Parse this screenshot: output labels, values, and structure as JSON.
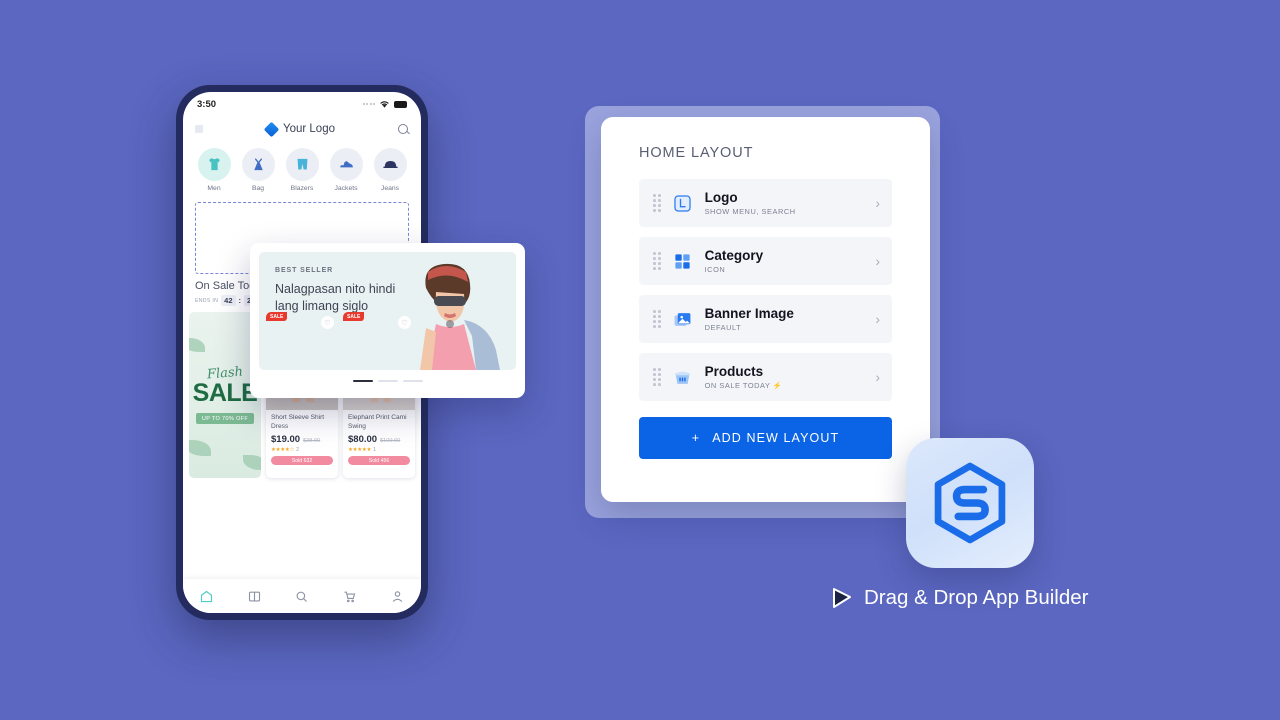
{
  "background_color": "#5b67c0",
  "phone": {
    "status_bar": {
      "time": "3:50",
      "wifi_icon": "wifi-icon",
      "battery_icon": "battery-icon",
      "signal_icon": "signal-dots-icon"
    },
    "app_header": {
      "menu_icon": "grid-menu-icon",
      "logo_icon": "diamond-logo-icon",
      "title": "Your Logo",
      "search_icon": "search-icon"
    },
    "categories": [
      {
        "label": "Men",
        "icon": "tshirt-icon"
      },
      {
        "label": "Bag",
        "icon": "dress-icon"
      },
      {
        "label": "Blazers",
        "icon": "shorts-icon"
      },
      {
        "label": "Jackets",
        "icon": "shoe-icon"
      },
      {
        "label": "Jeans",
        "icon": "cap-icon"
      }
    ],
    "on_sale": {
      "title": "On Sale Today",
      "ends_in_label": "ENDS IN",
      "hours": "42",
      "separator": ":",
      "minutes": "24"
    },
    "flash_banner": {
      "script_text": "Flash",
      "headline": "SALE",
      "pill": "UP TO 70% OFF"
    },
    "products": [
      {
        "tag": "SALE",
        "name": "Short Sleeve Shirt Dress",
        "price": "$19.00",
        "old_price": "$38.00",
        "stars": "★★★★☆",
        "rating_count": "2",
        "sold": "Sold 632",
        "favorite_icon": "heart-icon"
      },
      {
        "tag": "SALE",
        "name": "Elephant Print Cami Swing",
        "price": "$80.00",
        "old_price": "$100.00",
        "stars": "★★★★★",
        "rating_count": "1",
        "sold": "Sold 456",
        "favorite_icon": "heart-icon"
      }
    ],
    "bottom_nav": [
      {
        "icon": "home-icon",
        "active": true
      },
      {
        "icon": "book-icon",
        "active": false
      },
      {
        "icon": "search-icon",
        "active": false
      },
      {
        "icon": "cart-icon",
        "active": false
      },
      {
        "icon": "profile-icon",
        "active": false
      }
    ]
  },
  "best_seller_card": {
    "eyebrow": "BEST SELLER",
    "headline": "Nalagpasan nito hindi lang limang siglo",
    "image": "woman-with-sunglasses-photo",
    "pagination_dots": 3,
    "active_dot": 0
  },
  "builder_panel": {
    "title": "HOME LAYOUT",
    "rows": [
      {
        "title": "Logo",
        "subtitle": "SHOW MENU, SEARCH",
        "icon": "logo-letter-l-icon",
        "drag_handle": "drag-handle-icon",
        "chevron": "chevron-right-icon"
      },
      {
        "title": "Category",
        "subtitle": "ICON",
        "icon": "grid-squares-icon",
        "drag_handle": "drag-handle-icon",
        "chevron": "chevron-right-icon"
      },
      {
        "title": "Banner Image",
        "subtitle": "DEFAULT",
        "icon": "image-stack-icon",
        "drag_handle": "drag-handle-icon",
        "chevron": "chevron-right-icon"
      },
      {
        "title": "Products",
        "subtitle": "ON SALE TODAY ⚡",
        "icon": "basket-icon",
        "drag_handle": "drag-handle-icon",
        "chevron": "chevron-right-icon"
      }
    ],
    "add_button": {
      "label": "ADD NEW LAYOUT",
      "plus_icon": "plus-icon",
      "color": "#0b63e5"
    }
  },
  "branding": {
    "app_icon": "hexagon-s-monogram-icon",
    "tagline_icon": "cursor-play-icon",
    "tagline": "Drag & Drop App Builder"
  }
}
